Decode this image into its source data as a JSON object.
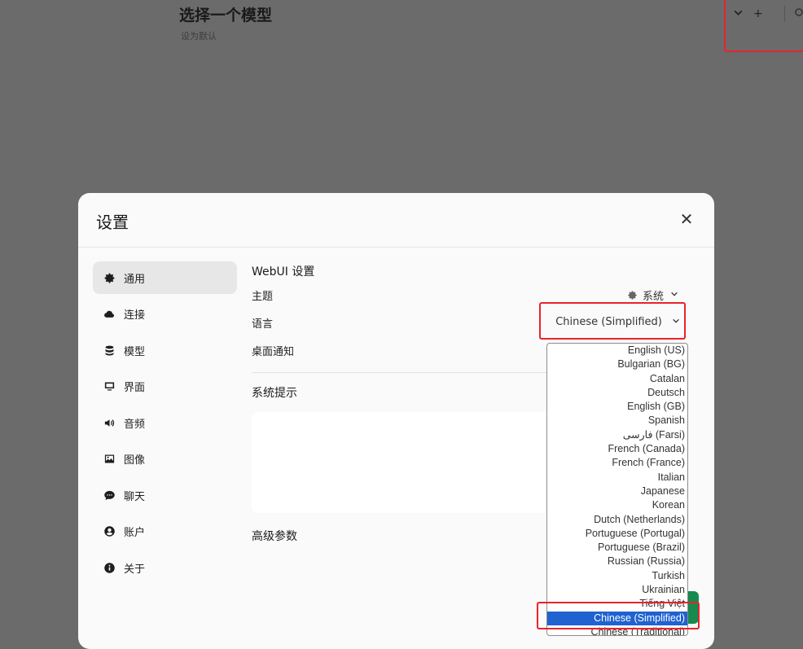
{
  "background": {
    "title": "选择一个模型",
    "subtitle": "设为默认",
    "tools": {
      "dropdown_icon": "chevron-down-icon",
      "add_label": "+",
      "extra_icon": "gear-icon"
    }
  },
  "modal": {
    "title": "设置",
    "close_label": "✕",
    "sidebar": [
      {
        "label": "通用",
        "icon": "gear-icon",
        "active": true
      },
      {
        "label": "连接",
        "icon": "cloud-icon"
      },
      {
        "label": "模型",
        "icon": "database-icon"
      },
      {
        "label": "界面",
        "icon": "monitor-icon"
      },
      {
        "label": "音频",
        "icon": "speaker-icon"
      },
      {
        "label": "图像",
        "icon": "image-icon"
      },
      {
        "label": "聊天",
        "icon": "chat-icon"
      },
      {
        "label": "账户",
        "icon": "user-icon"
      },
      {
        "label": "关于",
        "icon": "info-icon"
      }
    ],
    "general": {
      "section_title": "WebUI 设置",
      "theme_label": "主题",
      "theme_value": "系统",
      "language_label": "语言",
      "language_value": "Chinese (Simplified)",
      "notifications_label": "桌面通知",
      "system_prompt_label": "系统提示",
      "system_prompt_value": "",
      "advanced_label": "高级参数"
    }
  },
  "language_options": [
    "English (US)",
    "Bulgarian (BG)",
    "Catalan",
    "Deutsch",
    "English (GB)",
    "Spanish",
    "فارسی (Farsi)",
    "French (Canada)",
    "French (France)",
    "Italian",
    "Japanese",
    "Korean",
    "Dutch (Netherlands)",
    "Portuguese (Portugal)",
    "Portuguese (Brazil)",
    "Russian (Russia)",
    "Turkish",
    "Ukrainian",
    "Tiếng Việt",
    "Chinese (Simplified)",
    "Chinese (Traditional)"
  ],
  "language_selected": "Chinese (Simplified)",
  "highlight_color": "#e8242a",
  "select_color": "#1f62d0"
}
